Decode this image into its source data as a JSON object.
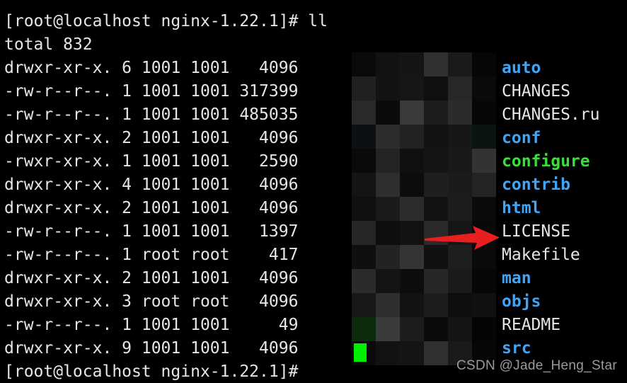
{
  "terminal": {
    "background_color": "#000000",
    "foreground_color": "#e6e6e6",
    "dir_color": "#41a4f5",
    "exec_color": "#3ae03a",
    "cursor_color": "#00ee00",
    "arrow_color": "#e81f1f",
    "prompt_command_line": "[root@localhost nginx-1.22.1]# ll",
    "total_line": "total 832",
    "final_prompt": "[root@localhost nginx-1.22.1]#"
  },
  "listing": [
    {
      "meta": "drwxr-xr-x. 6 1001 1001   4096",
      "name": "auto",
      "kind": "dir"
    },
    {
      "meta": "-rw-r--r--. 1 1001 1001 317399",
      "name": "CHANGES",
      "kind": "plain"
    },
    {
      "meta": "-rw-r--r--. 1 1001 1001 485035",
      "name": "CHANGES.ru",
      "kind": "plain"
    },
    {
      "meta": "drwxr-xr-x. 2 1001 1001   4096",
      "name": "conf",
      "kind": "dir"
    },
    {
      "meta": "-rwxr-xr-x. 1 1001 1001   2590",
      "name": "configure",
      "kind": "exec"
    },
    {
      "meta": "drwxr-xr-x. 4 1001 1001   4096",
      "name": "contrib",
      "kind": "dir"
    },
    {
      "meta": "drwxr-xr-x. 2 1001 1001   4096",
      "name": "html",
      "kind": "dir"
    },
    {
      "meta": "-rw-r--r--. 1 1001 1001   1397",
      "name": "LICENSE",
      "kind": "plain"
    },
    {
      "meta": "-rw-r--r--. 1 root root    417",
      "name": "Makefile",
      "kind": "plain"
    },
    {
      "meta": "drwxr-xr-x. 2 1001 1001   4096",
      "name": "man",
      "kind": "dir"
    },
    {
      "meta": "drwxr-xr-x. 3 root root   4096",
      "name": "objs",
      "kind": "dir"
    },
    {
      "meta": "-rw-r--r--. 1 1001 1001     49",
      "name": "README",
      "kind": "plain"
    },
    {
      "meta": "drwxr-xr-x. 9 1001 1001   4096",
      "name": "src",
      "kind": "dir"
    }
  ],
  "annotation": {
    "arrow_target": "Makefile",
    "arrow_color": "#e81f1f"
  },
  "watermark": {
    "text": "CSDN @Jade_Heng_Star"
  },
  "mosaic": {
    "shades": [
      "#0a0a0a",
      "#121212",
      "#151515",
      "#303030",
      "#1a1a1a",
      "#040608",
      "#202020",
      "#131313",
      "#161616",
      "#101010",
      "#282828",
      "#0a0a0a",
      "#2a2a2a",
      "#0b0b0b",
      "#3a3a3a",
      "#1c1c1c",
      "#2b2b2b",
      "#070707",
      "#0d1012",
      "#2d2d2d",
      "#222222",
      "#121212",
      "#171717",
      "#0a1410",
      "#0a0a0a",
      "#242424",
      "#101010",
      "#141414",
      "#191919",
      "#333333",
      "#141414",
      "#2e2e2e",
      "#0c0c0c",
      "#1f1f1f",
      "#1b1b1b",
      "#242424",
      "#101010",
      "#1b1b1b",
      "#2c2c2c",
      "#131313",
      "#1d1d1d",
      "#0b0b0b",
      "#262626",
      "#0e0e0e",
      "#121212",
      "#2a2a2a",
      "#161616",
      "#090909",
      "#0f0f0f",
      "#232323",
      "#343434",
      "#111111",
      "#1e1e1e",
      "#0a0a0a",
      "#2b2b2b",
      "#141414",
      "#0d0d0d",
      "#272727",
      "#1a1a1a",
      "#060606",
      "#181818",
      "#2f2f2f",
      "#121212",
      "#1c1c1c",
      "#0e0e0e",
      "#101010",
      "#0c2a0c",
      "#3a3a3a",
      "#1d1d1d",
      "#0a0a0a",
      "#151515",
      "#050505"
    ]
  }
}
